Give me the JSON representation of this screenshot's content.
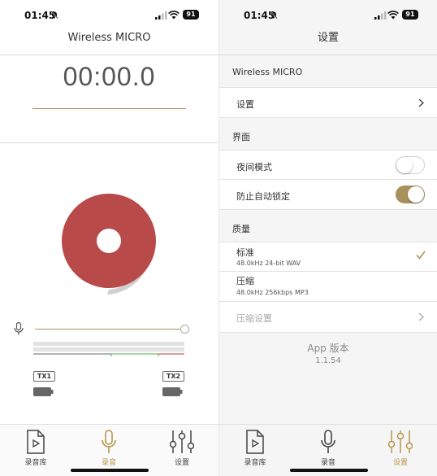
{
  "status_bar": {
    "time": "01:45",
    "battery": "91"
  },
  "recorder": {
    "title": "Wireless MICRO",
    "timer": "00:00.0",
    "gain_level": 1.0,
    "tx1_label": "TX1",
    "tx2_label": "TX2"
  },
  "settings": {
    "title": "设置",
    "device_name": "Wireless MICRO",
    "settings_item": "设置",
    "section_interface": "界面",
    "night_mode": "夜间模式",
    "night_mode_on": false,
    "prevent_lock": "防止自动锁定",
    "prevent_lock_on": true,
    "section_quality": "质量",
    "standard": "标准",
    "standard_desc": "48.0kHz 24-bit WAV",
    "compressed": "压缩",
    "compressed_desc": "48.0kHz 256kbps MP3",
    "compression_settings": "压缩设置",
    "app_version_label": "App 版本",
    "app_version": "1.1.54"
  },
  "tabs": [
    {
      "label": "录音库",
      "icon": "library-icon"
    },
    {
      "label": "录音",
      "icon": "mic-icon"
    },
    {
      "label": "设置",
      "icon": "settings-sliders-icon"
    }
  ],
  "colors": {
    "accent": "#b8964a",
    "record": "#b84a4a"
  }
}
